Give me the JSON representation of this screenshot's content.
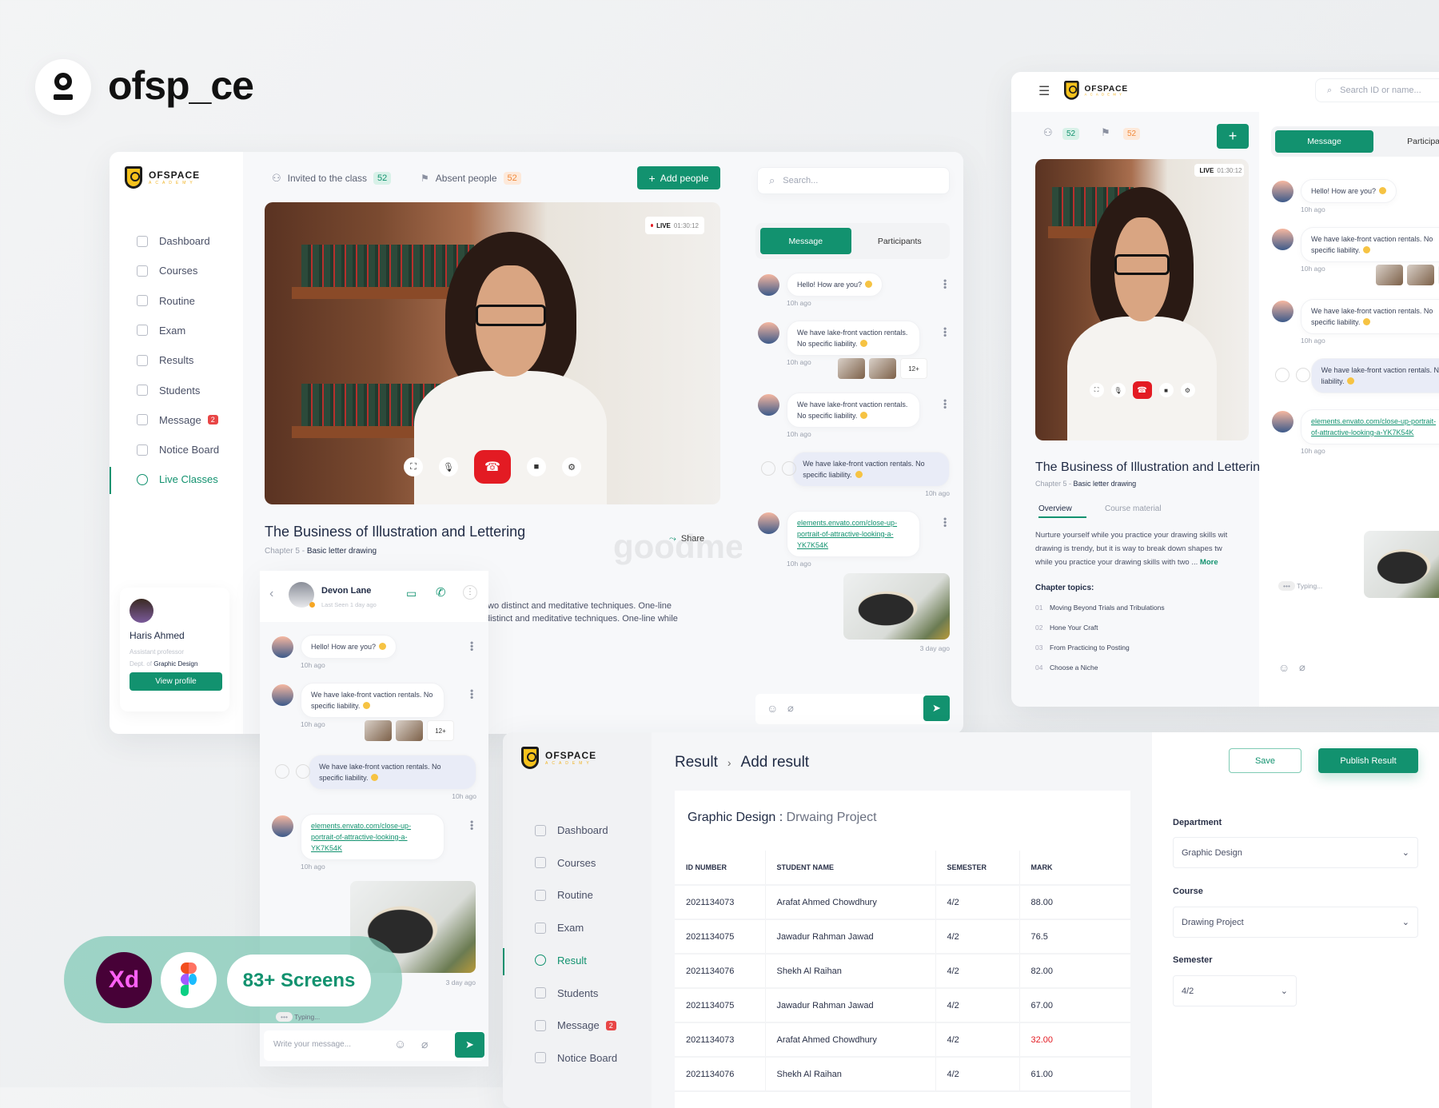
{
  "brand": {
    "name": "ofsp_ce",
    "watermark": "goodme.com"
  },
  "colors": {
    "accent": "#12926f",
    "danger": "#e31b23",
    "badge_orange": "#f08a3c"
  },
  "logo": {
    "name": "OFSPACE",
    "tagline": "ACADEMY"
  },
  "live_window": {
    "nav": [
      {
        "label": "Dashboard",
        "icon": "dashboard-icon"
      },
      {
        "label": "Courses",
        "icon": "courses-icon"
      },
      {
        "label": "Routine",
        "icon": "routine-icon"
      },
      {
        "label": "Exam",
        "icon": "exam-icon"
      },
      {
        "label": "Results",
        "icon": "results-icon"
      },
      {
        "label": "Students",
        "icon": "students-icon"
      },
      {
        "label": "Message",
        "icon": "message-icon",
        "badge": "2"
      },
      {
        "label": "Notice Board",
        "icon": "notice-board-icon"
      },
      {
        "label": "Live Classes",
        "icon": "live-classes-icon",
        "active": true
      }
    ],
    "header": {
      "invited_label": "Invited to the class",
      "invited_count": "52",
      "absent_label": "Absent people",
      "absent_count": "52",
      "add_label": "Add people"
    },
    "video": {
      "live": "LIVE",
      "timer": "01:30:12"
    },
    "course": {
      "title": "The Business of Illustration and Lettering",
      "chapter_prefix": "Chapter 5 -",
      "chapter_name": "Basic letter drawing",
      "share": "Share",
      "desc": [
        "two distinct and meditative techniques. One-line",
        "distinct and meditative techniques. One-line while"
      ]
    },
    "profile": {
      "name": "Haris Ahmed",
      "role": "Assistant professor",
      "dept_prefix": "Dept. of",
      "dept": "Graphic Design",
      "button": "View profile"
    },
    "chat": {
      "search_placeholder": "Search...",
      "tabs": [
        "Message",
        "Participants"
      ],
      "image_time": "3 day ago",
      "messages": [
        {
          "text": "Hello! How are you?",
          "time": "10h ago",
          "emoji": true
        },
        {
          "text": "We have lake-front vaction rentals. No specific liability.",
          "time": "10h ago",
          "emoji": true,
          "thumbs": "12+"
        },
        {
          "text": "We have lake-front vaction rentals. No specific liability.",
          "time": "10h ago",
          "emoji": true
        },
        {
          "text": "We have lake-front vaction rentals. No specific liability.",
          "time": "10h ago",
          "emoji": true,
          "own": true
        },
        {
          "link": "elements.envato.com/close-up-portrait-of-attractive-looking-a-YK7K54K",
          "time": "10h ago"
        }
      ]
    }
  },
  "tablet_window": {
    "search_placeholder": "Search ID or name...",
    "invited_count": "52",
    "absent_count": "52",
    "video": {
      "live": "LIVE",
      "timer": "01:30:12"
    },
    "course": {
      "title": "The Business of Illustration and Lettering",
      "chapter_prefix": "Chapter 5 -",
      "chapter_name": "Basic letter drawing",
      "tabs": [
        "Overview",
        "Course material"
      ],
      "desc": [
        "Nurture yourself while you practice your drawing skills wit",
        "drawing is trendy, but it is way to break down shapes tw",
        "while you practice your drawing skills with two ..."
      ],
      "more": "More",
      "topics_title": "Chapter topics:",
      "topics": [
        {
          "n": "01",
          "t": "Moving Beyond Trials and Tribulations"
        },
        {
          "n": "02",
          "t": "Hone Your Craft"
        },
        {
          "n": "03",
          "t": "From Practicing to Posting"
        },
        {
          "n": "04",
          "t": "Choose a Niche"
        }
      ]
    },
    "chat": {
      "tabs": [
        "Message",
        "Participan"
      ],
      "typing": "Typing...",
      "messages": [
        {
          "text": "Hello! How are you?",
          "time": "10h ago",
          "emoji": true
        },
        {
          "text": "We have lake-front vaction rentals. No specific liability.",
          "time": "10h ago",
          "emoji": true,
          "thumbs": "12+"
        },
        {
          "text": "We have lake-front vaction rentals. No specific liability.",
          "time": "10h ago",
          "emoji": true
        },
        {
          "text": "We have lake-front vaction rentals. No specific liability.",
          "emoji": true,
          "own": true
        },
        {
          "link": "elements.envato.com/close-up-portrait-of-attractive-looking-a-YK7K54K",
          "time": "10h ago"
        }
      ]
    }
  },
  "dm_window": {
    "contact": {
      "name": "Devon Lane",
      "status": "Last Seen 1 day ago"
    },
    "typing": "Typing...",
    "input_placeholder": "Write your message...",
    "image_time": "3 day ago",
    "messages": [
      {
        "text": "Hello! How are you?",
        "time": "10h ago",
        "emoji": true
      },
      {
        "text": "We have lake-front vaction rentals. No specific liability.",
        "time": "10h ago",
        "emoji": true,
        "thumbs": "12+"
      },
      {
        "text": "We have lake-front vaction rentals. No specific liability.",
        "time": "10h ago",
        "emoji": true,
        "own": true
      },
      {
        "link": "elements.envato.com/close-up-portrait-of-attractive-looking-a-YK7K54K",
        "time": "10h ago"
      }
    ]
  },
  "result_window": {
    "nav": [
      {
        "label": "Dashboard"
      },
      {
        "label": "Courses"
      },
      {
        "label": "Routine"
      },
      {
        "label": "Exam"
      },
      {
        "label": "Result",
        "active": true
      },
      {
        "label": "Students"
      },
      {
        "label": "Message",
        "badge": "2"
      },
      {
        "label": "Notice Board"
      }
    ],
    "breadcrumb": [
      "Result",
      "Add result"
    ],
    "save": "Save",
    "publish": "Publish Result",
    "table_title": "Graphic Design :",
    "table_subtitle": "Drwaing Project",
    "columns": [
      "ID NUMBER",
      "STUDENT NAME",
      "SEMESTER",
      "MARK"
    ],
    "rows": [
      {
        "id": "2021134073",
        "name": "Arafat Ahmed Chowdhury",
        "semester": "4/2",
        "mark": "88.00"
      },
      {
        "id": "2021134075",
        "name": "Jawadur Rahman Jawad",
        "semester": "4/2",
        "mark": "76.5"
      },
      {
        "id": "2021134076",
        "name": "Shekh Al Raihan",
        "semester": "4/2",
        "mark": "82.00"
      },
      {
        "id": "2021134075",
        "name": "Jawadur Rahman Jawad",
        "semester": "4/2",
        "mark": "67.00"
      },
      {
        "id": "2021134073",
        "name": "Arafat Ahmed Chowdhury",
        "semester": "4/2",
        "mark": "32.00",
        "fail": true
      },
      {
        "id": "2021134076",
        "name": "Shekh Al Raihan",
        "semester": "4/2",
        "mark": "61.00"
      }
    ],
    "form": {
      "department_label": "Department",
      "department": "Graphic Design",
      "course_label": "Course",
      "course": "Drawing Project",
      "semester_label": "Semester",
      "semester": "4/2"
    }
  },
  "promo": {
    "xd": "Xd",
    "screens": "83+ Screens"
  }
}
